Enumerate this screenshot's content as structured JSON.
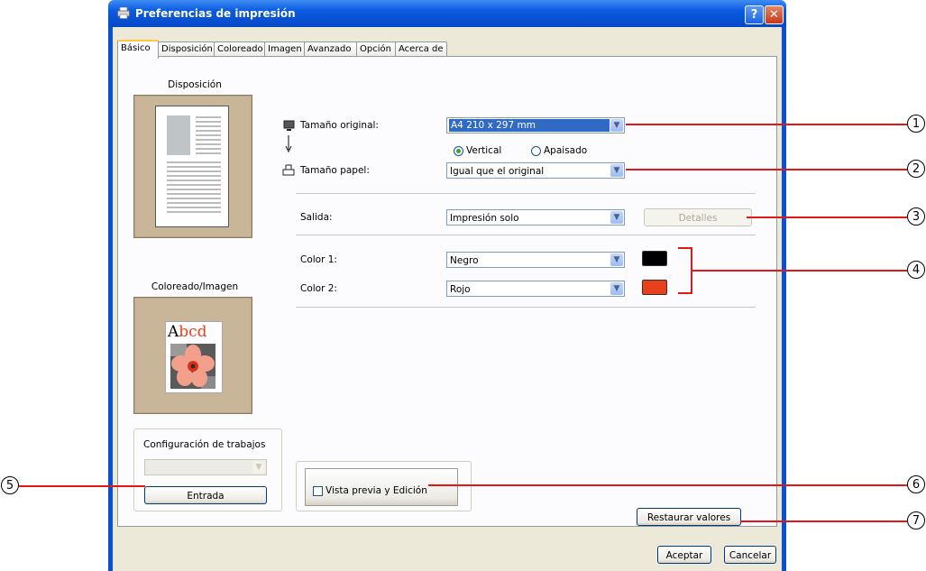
{
  "window": {
    "title": "Preferencias de impresión",
    "help_glyph": "?",
    "close_glyph": "✕"
  },
  "tabs": [
    {
      "label": "Básico",
      "active": true
    },
    {
      "label": "Disposición",
      "active": false
    },
    {
      "label": "Coloreado",
      "active": false
    },
    {
      "label": "Imagen",
      "active": false
    },
    {
      "label": "Avanzado",
      "active": false
    },
    {
      "label": "Opción",
      "active": false
    },
    {
      "label": "Acerca de",
      "active": false
    }
  ],
  "layout_preview": {
    "title": "Disposición"
  },
  "color_preview": {
    "title": "Coloreado/Imagen",
    "sample_text_a": "A",
    "sample_text_rest": "bcd"
  },
  "original_size": {
    "label": "Tamaño original:",
    "value": "A4 210 x 297 mm"
  },
  "orientation": {
    "vertical_label": "Vertical",
    "landscape_label": "Apaisado",
    "selected": "Vertical"
  },
  "paper_size": {
    "label": "Tamaño papel:",
    "value": "Igual que el original"
  },
  "output": {
    "label": "Salida:",
    "value": "Impresión solo",
    "details_button": "Detalles"
  },
  "color1": {
    "label": "Color 1:",
    "value": "Negro",
    "swatch": "#000000"
  },
  "color2": {
    "label": "Color 2:",
    "value": "Rojo",
    "swatch": "#e8401c"
  },
  "job_settings": {
    "title": "Configuración de trabajos",
    "value": "",
    "entry_button": "Entrada"
  },
  "preview_edit": {
    "label": "Vista previa y Edición",
    "checked": false
  },
  "restore_button": "Restaurar valores",
  "ok_button": "Aceptar",
  "cancel_button": "Cancelar",
  "callouts": [
    "1",
    "2",
    "3",
    "4",
    "5",
    "6",
    "7"
  ],
  "colors": {
    "callout_line": "#e01818",
    "title_bar": "#0a5be0",
    "selection": "#316ac5"
  }
}
